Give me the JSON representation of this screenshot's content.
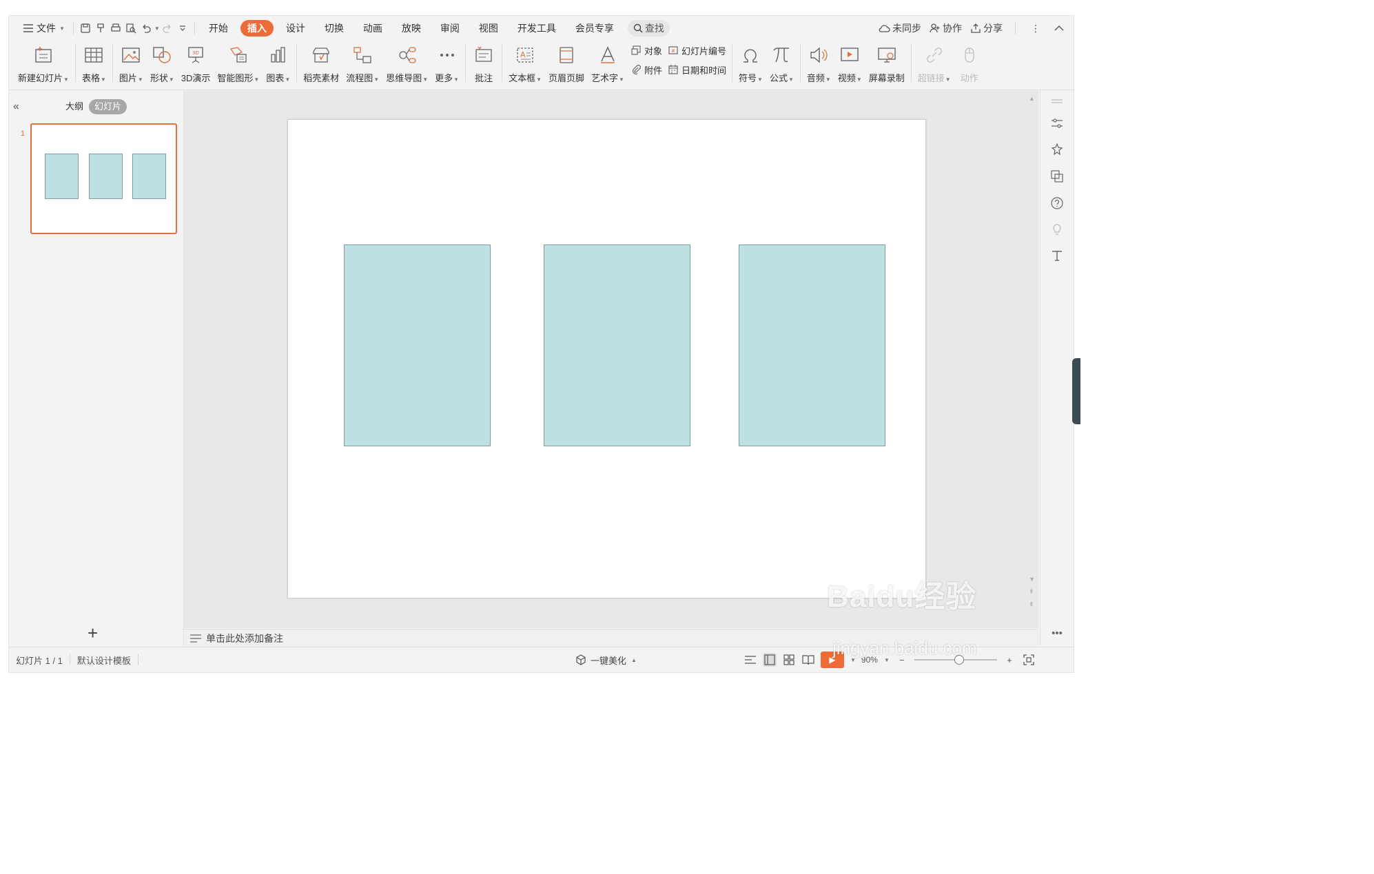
{
  "menubar": {
    "file_label": "文件",
    "tabs": [
      "开始",
      "插入",
      "设计",
      "切换",
      "动画",
      "放映",
      "审阅",
      "视图",
      "开发工具",
      "会员专享"
    ],
    "active_tab": "插入",
    "search_label": "查找",
    "right": {
      "sync_label": "未同步",
      "collab_label": "协作",
      "share_label": "分享"
    }
  },
  "ribbon": {
    "new_slide": "新建幻灯片",
    "table": "表格",
    "picture": "图片",
    "shape": "形状",
    "3d": "3D演示",
    "smartart": "智能图形",
    "chart": "图表",
    "material": "稻壳素材",
    "flowchart": "流程图",
    "mindmap": "思维导图",
    "more": "更多",
    "comment": "批注",
    "textbox": "文本框",
    "headerfooter": "页眉页脚",
    "wordart": "艺术字",
    "object": "对象",
    "attachment": "附件",
    "slide_number": "幻灯片编号",
    "datetime": "日期和时间",
    "symbol": "符号",
    "formula": "公式",
    "audio": "音频",
    "video": "视频",
    "screen_record": "屏幕录制",
    "hyperlink": "超链接",
    "action": "动作"
  },
  "leftpanel": {
    "outline_tab": "大纲",
    "slides_tab": "幻灯片",
    "thumb_number": "1",
    "add_slide": "+"
  },
  "notes": {
    "placeholder": "单击此处添加备注"
  },
  "status": {
    "slide_counter": "幻灯片 1 / 1",
    "template": "默认设计模板",
    "beautify": "一键美化",
    "zoom": "90%"
  },
  "colors": {
    "accent": "#ec6b36",
    "shape_fill": "#bde0e3",
    "shape_border": "#7e9aa3"
  },
  "watermark": {
    "brand": "Baidu经验",
    "url": "jingyan.baidu.com"
  }
}
